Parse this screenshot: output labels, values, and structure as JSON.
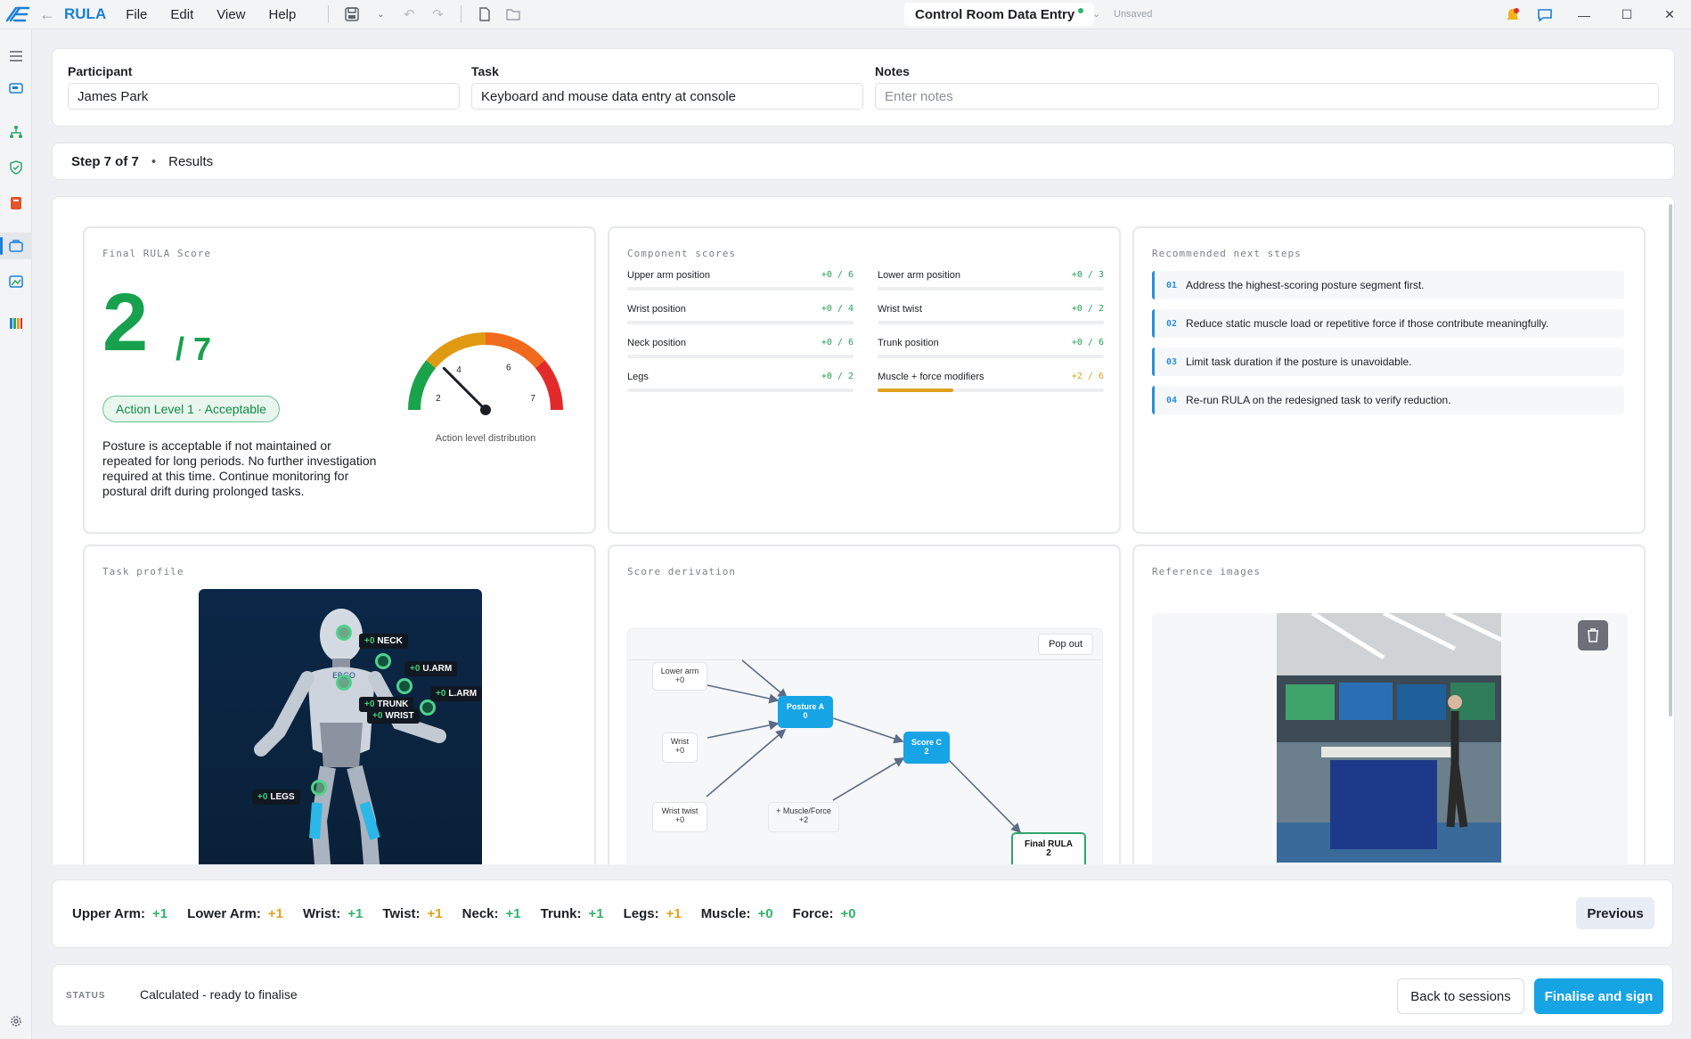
{
  "app": {
    "name": "RULA",
    "menu": [
      "File",
      "Edit",
      "View",
      "Help"
    ],
    "document_title": "Control Room Data Entry",
    "save_state": "Unsaved"
  },
  "colors": {
    "accent": "#1b7fd6",
    "green": "#22a05a",
    "orange": "#e0a11b",
    "red": "#e32a2a",
    "node_blue": "#16a4e4"
  },
  "form": {
    "participant": {
      "label": "Participant",
      "value": "James Park"
    },
    "task": {
      "label": "Task",
      "value": "Keyboard and mouse data entry at console"
    },
    "notes": {
      "label": "Notes",
      "value": "",
      "placeholder": "Enter notes"
    }
  },
  "stepper": {
    "step": "Step 7 of 7",
    "separator": "•",
    "name": "Results"
  },
  "final_score": {
    "title": "Final RULA Score",
    "score": "2",
    "max": "/ 7",
    "badge": "Action Level 1 · Acceptable",
    "description": "Posture is acceptable if not maintained or repeated for long periods. No further investigation required at this time. Continue monitoring for postural drift during prolonged tasks.",
    "gauge": {
      "ticks": [
        "2",
        "4",
        "6",
        "7"
      ],
      "caption": "Action level distribution",
      "value": 2,
      "min": 1,
      "max": 7
    }
  },
  "components": {
    "title": "Component scores",
    "items": [
      {
        "name": "Upper arm position",
        "value": "+0 / 6",
        "fraction": 0
      },
      {
        "name": "Lower arm position",
        "value": "+0 / 3",
        "fraction": 0
      },
      {
        "name": "Wrist position",
        "value": "+0 / 4",
        "fraction": 0
      },
      {
        "name": "Wrist twist",
        "value": "+0 / 2",
        "fraction": 0
      },
      {
        "name": "Neck position",
        "value": "+0 / 6",
        "fraction": 0
      },
      {
        "name": "Trunk position",
        "value": "+0 / 6",
        "fraction": 0
      },
      {
        "name": "Legs",
        "value": "+0 / 2",
        "fraction": 0
      },
      {
        "name": "Muscle + force modifiers",
        "value": "+2 / 6",
        "fraction": 0.333
      }
    ]
  },
  "recommendations": {
    "title": "Recommended next steps",
    "items": [
      {
        "num": "01",
        "text": "Address the highest-scoring posture segment first."
      },
      {
        "num": "02",
        "text": "Reduce static muscle load or repetitive force if those contribute meaningfully."
      },
      {
        "num": "03",
        "text": "Limit task duration if the posture is unavoidable."
      },
      {
        "num": "04",
        "text": "Re-run RULA on the redesigned task to verify reduction."
      }
    ]
  },
  "task_profile": {
    "title": "Task profile",
    "figure_brand": "ERGO",
    "tags": [
      {
        "delta": "+0",
        "name": "NECK"
      },
      {
        "delta": "+0",
        "name": "U.ARM"
      },
      {
        "delta": "+0",
        "name": "TRUNK"
      },
      {
        "delta": "+0",
        "name": "L.ARM"
      },
      {
        "delta": "+0",
        "name": "WRIST"
      },
      {
        "delta": "+0",
        "name": "LEGS"
      }
    ]
  },
  "derivation": {
    "title": "Score derivation",
    "popout": "Pop out",
    "nodes": {
      "lower_arm": {
        "label": "Lower arm",
        "value": "+0"
      },
      "wrist": {
        "label": "Wrist",
        "value": "+0"
      },
      "wrist_twist": {
        "label": "Wrist twist",
        "value": "+0"
      },
      "muscle": {
        "label": "+ Muscle/Force",
        "value": "+2"
      },
      "posture_a": {
        "label": "Posture A",
        "value": "0"
      },
      "score_c": {
        "label": "Score C",
        "value": "2"
      },
      "final": {
        "label": "Final RULA",
        "value": "2"
      }
    }
  },
  "reference": {
    "title": "Reference images"
  },
  "summary": [
    {
      "label": "Upper Arm:",
      "value": "+1",
      "tone": "g"
    },
    {
      "label": "Lower Arm:",
      "value": "+1",
      "tone": "o"
    },
    {
      "label": "Wrist:",
      "value": "+1",
      "tone": "g"
    },
    {
      "label": "Twist:",
      "value": "+1",
      "tone": "o"
    },
    {
      "label": "Neck:",
      "value": "+1",
      "tone": "g"
    },
    {
      "label": "Trunk:",
      "value": "+1",
      "tone": "g"
    },
    {
      "label": "Legs:",
      "value": "+1",
      "tone": "o"
    },
    {
      "label": "Muscle:",
      "value": "+0",
      "tone": "g"
    },
    {
      "label": "Force:",
      "value": "+0",
      "tone": "g"
    }
  ],
  "buttons": {
    "previous": "Previous",
    "back": "Back to sessions",
    "finalise": "Finalise and sign"
  },
  "status": {
    "label": "STATUS",
    "text": "Calculated - ready to finalise"
  }
}
